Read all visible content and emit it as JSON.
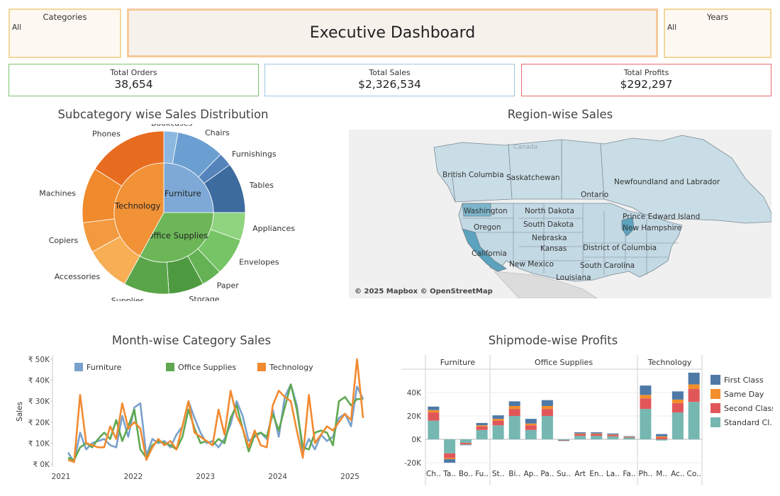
{
  "filters": {
    "categories": {
      "title": "Categories",
      "value": "All"
    },
    "years": {
      "title": "Years",
      "value": "All"
    }
  },
  "header": {
    "title": "Executive Dashboard"
  },
  "kpis": {
    "orders": {
      "label": "Total Orders",
      "value": "38,654",
      "color": "#7cc46f"
    },
    "sales": {
      "label": "Total Sales",
      "value": "$2,326,534",
      "color": "#9dc8e0"
    },
    "profits": {
      "label": "Total Profits",
      "value": "$292,297",
      "color": "#e36c6c"
    }
  },
  "sections": {
    "sunburst_title": "Subcategory wise Sales Distribution",
    "map_title": "Region-wise Sales",
    "line_title": "Month-wise Category Sales",
    "bar_title": "Shipmode-wise Profits"
  },
  "map": {
    "attribution": "© 2025 Mapbox © OpenStreetMap",
    "labels": [
      "Canada",
      "British Columbia",
      "Saskatchewan",
      "Newfoundland and Labrador",
      "Ontario",
      "Washington",
      "North Dakota",
      "Prince Edward Island",
      "Oregon",
      "South Dakota",
      "New Hampshire",
      "Nebraska",
      "District of Columbia",
      "Kansas",
      "California",
      "New Mexico",
      "South Carolina",
      "Louisiana"
    ]
  },
  "chart_data": [
    {
      "type": "pie",
      "title": "Subcategory wise Sales Distribution",
      "inner": [
        {
          "name": "Furniture",
          "value": 25,
          "color": "#7ea9d6"
        },
        {
          "name": "Office Supplies",
          "value": 33,
          "color": "#6cb658"
        },
        {
          "name": "Technology",
          "value": 42,
          "color": "#f19236"
        }
      ],
      "outer": [
        {
          "name": "Bookcases",
          "parent": "Furniture",
          "value": 2.8,
          "color": "#8cb7e0"
        },
        {
          "name": "Chairs",
          "parent": "Furniture",
          "value": 9.5,
          "color": "#6c9fd1"
        },
        {
          "name": "Furnishings",
          "parent": "Furniture",
          "value": 2.7,
          "color": "#5584bb"
        },
        {
          "name": "Tables",
          "parent": "Furniture",
          "value": 10.0,
          "color": "#3d6b9e"
        },
        {
          "name": "Appliances",
          "parent": "Office Supplies",
          "value": 5.5,
          "color": "#90d480"
        },
        {
          "name": "Envelopes",
          "parent": "Office Supplies",
          "value": 7.5,
          "color": "#76c466"
        },
        {
          "name": "Paper",
          "parent": "Office Supplies",
          "value": 4.0,
          "color": "#64b254"
        },
        {
          "name": "Storage",
          "parent": "Office Supplies",
          "value": 7.0,
          "color": "#4e9a40"
        },
        {
          "name": "Supplies",
          "parent": "Office Supplies",
          "value": 9.0,
          "color": "#5aa54a"
        },
        {
          "name": "Accessories",
          "parent": "Technology",
          "value": 9.0,
          "color": "#f7ae55"
        },
        {
          "name": "Copiers",
          "parent": "Technology",
          "value": 6.0,
          "color": "#f39a40"
        },
        {
          "name": "Machines",
          "parent": "Technology",
          "value": 11.0,
          "color": "#f08a2c"
        },
        {
          "name": "Phones",
          "parent": "Technology",
          "value": 16.0,
          "color": "#e86c20"
        }
      ]
    },
    {
      "type": "line",
      "title": "Month-wise Category Sales",
      "ylabel": "Sales",
      "ylim": [
        0,
        50000
      ],
      "yticks": [
        "₹ 0K",
        "₹ 10K",
        "₹ 20K",
        "₹ 30K",
        "₹ 40K",
        "₹ 50K"
      ],
      "xticks": [
        "2021",
        "2022",
        "2023",
        "2024",
        "2025"
      ],
      "x_start_year": 2021,
      "series": [
        {
          "name": "Furniture",
          "color": "#79a1cc",
          "values": [
            5500,
            1000,
            15000,
            7000,
            10000,
            11000,
            12000,
            9000,
            8000,
            23000,
            13000,
            27000,
            29000,
            4000,
            12000,
            10000,
            11000,
            8000,
            14000,
            18000,
            30000,
            22000,
            15000,
            10000,
            11000,
            8000,
            12000,
            19000,
            30000,
            23000,
            11000,
            13000,
            15000,
            12000,
            26000,
            13000,
            32000,
            38000,
            28000,
            5500,
            12000,
            7000,
            14000,
            11000,
            13000,
            22000,
            24000,
            18000,
            37000,
            31000
          ]
        },
        {
          "name": "Office Supplies",
          "color": "#5fa850",
          "values": [
            3000,
            2000,
            8000,
            10000,
            8000,
            12000,
            15000,
            12000,
            21000,
            11000,
            18000,
            26000,
            7000,
            3000,
            9000,
            11000,
            10000,
            9000,
            7000,
            13000,
            26000,
            17000,
            10000,
            11000,
            9000,
            12000,
            10000,
            22000,
            28000,
            17000,
            6000,
            14000,
            15000,
            13000,
            24000,
            16000,
            27000,
            38000,
            26000,
            8000,
            7000,
            15000,
            16000,
            15000,
            9000,
            30000,
            32000,
            28000,
            31000,
            31000
          ]
        },
        {
          "name": "Technology",
          "color": "#f28a30",
          "values": [
            2000,
            1000,
            33000,
            10000,
            9000,
            8000,
            8000,
            18000,
            12000,
            29000,
            17000,
            20000,
            17000,
            2000,
            8000,
            12000,
            9000,
            11000,
            7000,
            18000,
            30000,
            15000,
            13000,
            11000,
            9000,
            26000,
            14000,
            35000,
            23000,
            17000,
            8000,
            16000,
            9000,
            8000,
            28000,
            35000,
            32000,
            30000,
            16000,
            3000,
            33000,
            10000,
            14000,
            18000,
            16000,
            20000,
            24000,
            21000,
            50000,
            22000
          ]
        }
      ]
    },
    {
      "type": "bar",
      "title": "Shipmode-wise Profits",
      "stacked": true,
      "ylim": [
        -20000,
        60000
      ],
      "yticks": [
        "-20K",
        "0K",
        "20K",
        "40K"
      ],
      "groups": [
        "Furniture",
        "Office Supplies",
        "Technology"
      ],
      "categories": [
        "Ch..",
        "Ta..",
        "Bo..",
        "Fu..",
        "St..",
        "Bi..",
        "Ap..",
        "Pa..",
        "Su..",
        "Art",
        "En..",
        "La..",
        "Fa..",
        "Ph..",
        "M..",
        "Ac..",
        "Co.."
      ],
      "category_group": [
        0,
        0,
        0,
        0,
        1,
        1,
        1,
        1,
        1,
        1,
        1,
        1,
        1,
        2,
        2,
        2,
        2
      ],
      "series": [
        {
          "name": "Standard Cl..",
          "color": "#76b7b2",
          "values": [
            16000,
            -12000,
            -3000,
            8000,
            12000,
            20000,
            8000,
            20000,
            -600,
            3000,
            3000,
            2500,
            1500,
            26000,
            -1000,
            23000,
            32000
          ]
        },
        {
          "name": "Second Class",
          "color": "#e15759",
          "values": [
            7000,
            -4000,
            -1000,
            3000,
            4000,
            6000,
            4000,
            6000,
            -300,
            1500,
            1500,
            1200,
            600,
            9000,
            1500,
            8000,
            11000
          ]
        },
        {
          "name": "Same Day",
          "color": "#f28e2b",
          "values": [
            2000,
            -1000,
            -400,
            1000,
            1500,
            2500,
            1500,
            2500,
            -100,
            500,
            500,
            400,
            200,
            3000,
            1000,
            3000,
            4000
          ]
        },
        {
          "name": "First Class",
          "color": "#4e79a7",
          "values": [
            3000,
            -3000,
            -600,
            2000,
            3000,
            4000,
            4000,
            5000,
            -400,
            1000,
            1000,
            900,
            400,
            8000,
            2000,
            7000,
            10000
          ]
        }
      ]
    }
  ]
}
